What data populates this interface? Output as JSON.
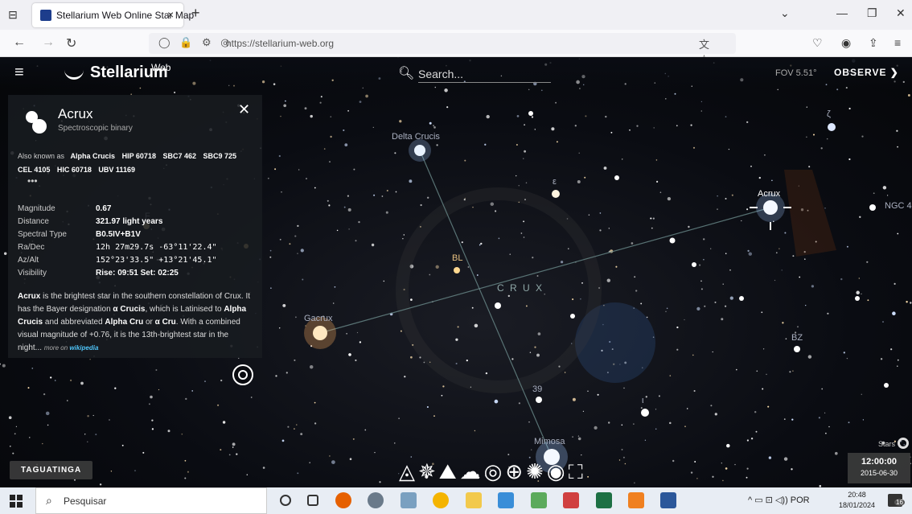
{
  "browser": {
    "tab_title": "Stellarium Web Online Star Map",
    "tab_close": "×",
    "new_tab": "+",
    "url": "https://stellarium-web.org",
    "window_controls": [
      "⌄",
      "—",
      "❐",
      "✕"
    ]
  },
  "app": {
    "logo_text": "Stellarium",
    "logo_sup": "Web",
    "search_placeholder": "Search...",
    "fov": "FOV 5.51°",
    "observe": "OBSERVE ❯"
  },
  "info": {
    "name": "Acrux",
    "type": "Spectroscopic binary",
    "close": "✕",
    "aka_label": "Also known as",
    "aka_names": [
      "Alpha Crucis",
      "HIP 60718",
      "SBC7 462",
      "SBC9 725",
      "CEL 4105",
      "HIC 60718",
      "UBV 11169"
    ],
    "more": "•••",
    "props": [
      {
        "label": "Magnitude",
        "value": "0.67"
      },
      {
        "label": "Distance",
        "value": "321.97 light years"
      },
      {
        "label": "Spectral Type",
        "value": "B0.5IV+B1V"
      },
      {
        "label": "Ra/Dec",
        "value": "12h 27m29.7s   -63°11'22.4\""
      },
      {
        "label": "Az/Alt",
        "value": "152°23'33.5\"   +13°21'45.1\""
      },
      {
        "label": "Visibility",
        "value": "Rise: 09:51   Set: 02:25"
      }
    ],
    "desc_parts": {
      "b1": "Acrux",
      "t1": " is the brightest star in the southern constellation of Crux. It has the Bayer designation ",
      "b2": "α Crucis",
      "t2": ", which is Latinised to ",
      "b3": "Alpha Crucis",
      "t3": " and abbreviated ",
      "b4": "Alpha Cru",
      "t4": " or ",
      "b5": "α Cru",
      "t5": ". With a combined visual magnitude of +0.76, it is the 13th-brightest star in the night... ",
      "more": "more on ",
      "wiki": "wikipedia"
    }
  },
  "sky": {
    "constellation": "C R U X",
    "labels": {
      "delta_crucis": "Delta Crucis",
      "acrux": "Acrux",
      "gacrux": "Gacrux",
      "mimosa": "Mimosa",
      "bl": "BL",
      "epsilon": "ε",
      "bz": "BZ",
      "n39": "39",
      "ngc": "NGC 4",
      "f": "F",
      "zeta": "ζ",
      "iota": "ι"
    },
    "location": "TAGUATINGA",
    "stars_label": "Stars",
    "time": "12:00:00",
    "date": "2015-06-30"
  },
  "taskbar": {
    "search_placeholder": "Pesquisar",
    "tray": "^  ▭  ⊡  ◁))  POR",
    "time": "20:48",
    "date": "18/01/2024",
    "notif_count": "16"
  }
}
